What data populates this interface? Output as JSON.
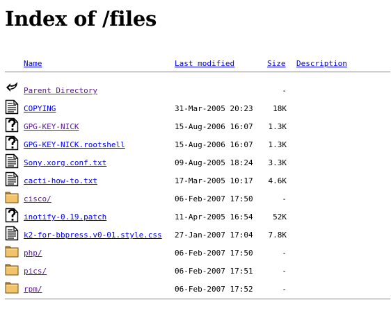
{
  "page": {
    "title": "Index of /files"
  },
  "columns": {
    "name": "Name",
    "last_modified": "Last modified",
    "size": "Size",
    "description": "Description"
  },
  "entries": [
    {
      "icon": "back-icon",
      "name": "Parent Directory",
      "modified": "",
      "size": "-",
      "visited": true
    },
    {
      "icon": "text-file-icon",
      "name": "COPYING",
      "modified": "31-Mar-2005 20:23",
      "size": "18K",
      "visited": false
    },
    {
      "icon": "unknown-file-icon",
      "name": "GPG-KEY-NICK",
      "modified": "15-Aug-2006 16:07",
      "size": "1.3K",
      "visited": true
    },
    {
      "icon": "unknown-file-icon",
      "name": "GPG-KEY-NICK.rootshell",
      "modified": "15-Aug-2006 16:07",
      "size": "1.3K",
      "visited": false
    },
    {
      "icon": "text-file-icon",
      "name": "Sony.xorg.conf.txt",
      "modified": "09-Aug-2005 18:24",
      "size": "3.3K",
      "visited": false
    },
    {
      "icon": "text-file-icon",
      "name": "cacti-how-to.txt",
      "modified": "17-Mar-2005 10:17",
      "size": "4.6K",
      "visited": false
    },
    {
      "icon": "folder-icon",
      "name": "cisco/",
      "modified": "06-Feb-2007 17:50",
      "size": "-",
      "visited": true
    },
    {
      "icon": "unknown-file-icon",
      "name": "inotify-0.19.patch",
      "modified": "11-Apr-2005 16:54",
      "size": "52K",
      "visited": false
    },
    {
      "icon": "text-file-icon",
      "name": "k2-for-bbpress.v0-01.style.css",
      "modified": "27-Jan-2007 17:04",
      "size": "7.8K",
      "visited": false
    },
    {
      "icon": "folder-icon",
      "name": "php/",
      "modified": "06-Feb-2007 17:50",
      "size": "-",
      "visited": true
    },
    {
      "icon": "folder-icon",
      "name": "pics/",
      "modified": "06-Feb-2007 17:51",
      "size": "-",
      "visited": true
    },
    {
      "icon": "folder-icon",
      "name": "rpm/",
      "modified": "06-Feb-2007 17:52",
      "size": "-",
      "visited": true
    }
  ]
}
